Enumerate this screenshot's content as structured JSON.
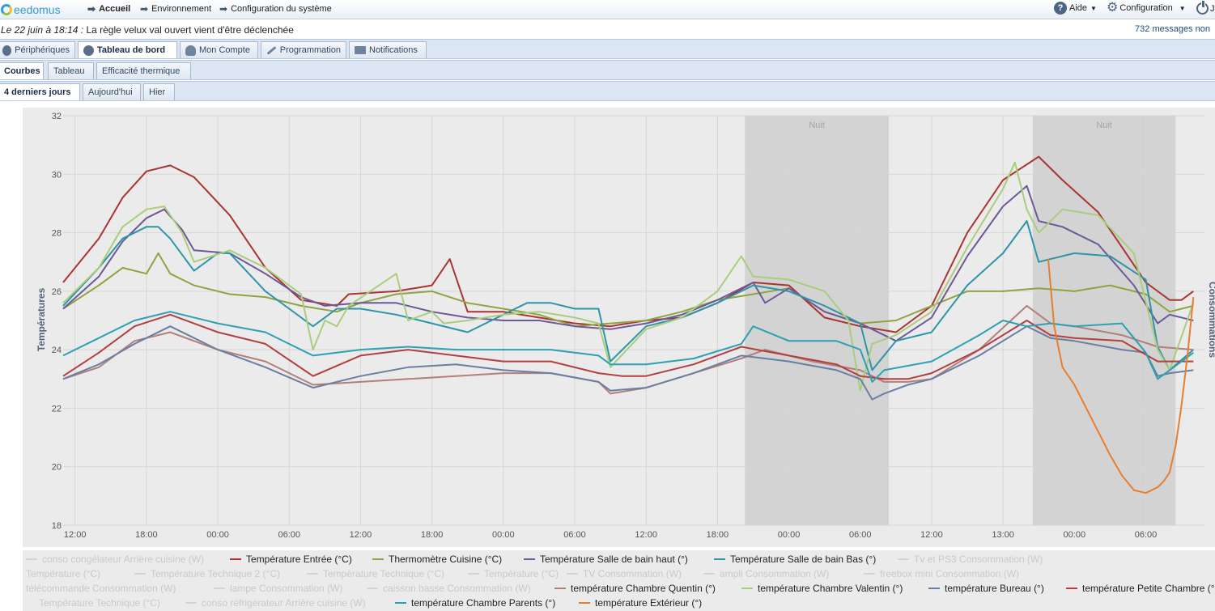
{
  "topbar": {
    "logo": "eedomus",
    "nav": [
      "Accueil",
      "Environnement",
      "Configuration du système"
    ],
    "help": "Aide",
    "config": "Configuration",
    "user_initial": "J"
  },
  "message": {
    "date": "Le 22 juin à 18:14 :",
    "text": "La règle velux val ouvert vient d'être déclenchée",
    "count": "732 messages non"
  },
  "main_tabs": [
    "Périphériques",
    "Tableau de bord",
    "Mon Compte",
    "Programmation",
    "Notifications"
  ],
  "sub_tabs": [
    "Courbes",
    "Tableau",
    "Efficacité thermique"
  ],
  "period_tabs": [
    "4 derniers jours",
    "Aujourd'hui",
    "Hier"
  ],
  "chart_data": {
    "type": "line",
    "ylabel": "Températures",
    "y2label": "Consommations",
    "ylim": [
      18,
      32
    ],
    "yticks": [
      18,
      20,
      22,
      24,
      26,
      28,
      30,
      32
    ],
    "xticks": [
      "12:00",
      "18:00",
      "00:00",
      "06:00",
      "12:00",
      "18:00",
      "00:00",
      "06:00",
      "12:00",
      "18:00",
      "00:00",
      "06:00",
      "12:00",
      "13:00",
      "00:00",
      "06:00"
    ],
    "x_hours": [
      0,
      6,
      12,
      18,
      24,
      30,
      36,
      42,
      48,
      54,
      60,
      66,
      72,
      78,
      84,
      90
    ],
    "x_range": [
      -1,
      95
    ],
    "night_bands": [
      {
        "label": "Nuit",
        "from": 56.3,
        "to": 68.4
      },
      {
        "label": "Nuit",
        "from": 80.5,
        "to": 92.5
      }
    ],
    "series": [
      {
        "name": "Température Entrée (°C)",
        "color": "#aa3333",
        "x": [
          -1,
          2,
          4,
          6,
          8,
          10,
          13,
          16,
          19,
          22,
          23,
          27,
          30,
          31.5,
          33,
          36,
          39,
          42,
          45,
          48,
          51,
          54,
          57,
          60,
          63,
          66,
          69,
          72,
          75,
          78,
          81,
          83,
          86,
          88,
          90,
          92,
          93,
          94
        ],
        "values": [
          26.3,
          27.8,
          29.2,
          30.1,
          30.3,
          29.9,
          28.6,
          26.8,
          25.7,
          25.5,
          25.9,
          26.0,
          26.2,
          27.1,
          25.3,
          25.3,
          25.1,
          24.9,
          24.8,
          25.0,
          25.1,
          25.6,
          26.3,
          26.2,
          25.1,
          24.8,
          24.6,
          25.5,
          28.0,
          29.8,
          30.6,
          29.8,
          28.7,
          27.5,
          26.3,
          25.7,
          25.7,
          26.0
        ]
      },
      {
        "name": "Thermomètre Cuisine (°C)",
        "color": "#8ea440",
        "x": [
          -1,
          2,
          4,
          6,
          7,
          8,
          10,
          13,
          16,
          19,
          22,
          24,
          27,
          30,
          33,
          36,
          39,
          42,
          45,
          48,
          51,
          54,
          57,
          60,
          63,
          66,
          69,
          72,
          75,
          78,
          81,
          84,
          87,
          90,
          92,
          94
        ],
        "values": [
          25.4,
          26.2,
          26.8,
          26.6,
          27.3,
          26.6,
          26.2,
          25.9,
          25.8,
          25.5,
          25.3,
          25.6,
          25.9,
          26.0,
          25.6,
          25.4,
          25.2,
          24.8,
          24.9,
          25.0,
          25.3,
          25.7,
          25.9,
          26.1,
          25.3,
          24.9,
          25.0,
          25.5,
          26.0,
          26.0,
          26.1,
          26.0,
          26.2,
          25.9,
          25.3,
          25.5
        ]
      },
      {
        "name": "Température Salle de bain haut (°)",
        "color": "#6d5898",
        "x": [
          -1,
          2,
          4,
          6,
          7.5,
          9,
          10,
          13,
          16,
          19,
          21,
          24,
          27,
          30,
          33,
          36,
          39,
          42,
          45,
          48,
          51,
          54,
          57,
          58,
          60,
          63,
          66,
          69,
          72,
          75,
          78,
          80,
          81,
          83,
          86,
          89,
          91,
          92,
          94
        ],
        "values": [
          25.4,
          26.5,
          27.7,
          28.5,
          28.8,
          28.1,
          27.4,
          27.3,
          26.6,
          25.8,
          25.5,
          25.6,
          25.6,
          25.3,
          25.1,
          25.0,
          25.0,
          24.8,
          24.7,
          24.9,
          25.2,
          25.7,
          26.3,
          25.6,
          26.1,
          25.3,
          24.9,
          24.3,
          25.1,
          27.2,
          28.9,
          29.6,
          28.4,
          28.2,
          27.6,
          26.2,
          24.9,
          25.2,
          25.0
        ]
      },
      {
        "name": "Température Salle de bain Bas (°)",
        "color": "#2e94a8",
        "x": [
          -1,
          2,
          4,
          6,
          7,
          8,
          10,
          12,
          13,
          16,
          18,
          20,
          22,
          24,
          27,
          30,
          33,
          36,
          38,
          40,
          42,
          44,
          45,
          48,
          51,
          54,
          57,
          60,
          63,
          66,
          67,
          69,
          72,
          75,
          78,
          80,
          81,
          84,
          87,
          90,
          91,
          92,
          94
        ],
        "values": [
          25.5,
          26.8,
          27.8,
          28.2,
          28.2,
          27.8,
          26.7,
          27.3,
          27.3,
          26.0,
          25.4,
          24.8,
          25.4,
          25.4,
          25.2,
          24.9,
          24.6,
          25.2,
          25.6,
          25.6,
          25.4,
          25.4,
          23.6,
          24.8,
          25.1,
          25.6,
          26.2,
          26.0,
          25.5,
          24.9,
          23.3,
          24.3,
          24.6,
          26.2,
          27.3,
          28.4,
          27.0,
          27.3,
          27.2,
          26.4,
          24.1,
          23.3,
          24.0
        ]
      },
      {
        "name": "température Chambre Quentin (°)",
        "color": "#b27f7a",
        "x": [
          -1,
          2,
          5,
          8,
          12,
          16,
          20,
          24,
          28,
          32,
          36,
          40,
          44,
          45,
          48,
          52,
          56,
          58,
          62,
          66,
          68,
          70,
          72,
          76,
          80,
          82,
          84,
          88,
          91,
          94
        ],
        "values": [
          23.0,
          23.4,
          24.3,
          24.6,
          24.0,
          23.6,
          22.8,
          22.9,
          23.0,
          23.1,
          23.2,
          23.2,
          22.9,
          22.5,
          22.7,
          23.2,
          23.7,
          24.0,
          23.6,
          23.3,
          22.9,
          22.9,
          23.0,
          24.0,
          25.5,
          24.9,
          24.8,
          24.5,
          24.1,
          24.0
        ]
      },
      {
        "name": "température Chambre Valentin (°)",
        "color": "#a9cd7d",
        "x": [
          -1,
          2,
          4,
          6,
          7.5,
          9,
          10,
          13,
          16,
          19,
          20,
          21,
          22,
          23,
          27,
          28,
          30,
          31,
          33,
          36,
          39,
          42,
          44,
          45,
          48,
          51,
          54,
          56,
          57,
          60,
          63,
          65,
          66,
          67,
          69,
          72,
          75,
          78,
          79,
          80,
          81,
          83,
          86,
          89,
          91,
          92,
          94
        ],
        "values": [
          25.6,
          26.8,
          28.2,
          28.8,
          28.9,
          28.0,
          27.0,
          27.4,
          26.8,
          25.9,
          24.0,
          25.0,
          24.8,
          25.5,
          26.6,
          25.0,
          25.3,
          24.9,
          25.0,
          25.2,
          25.3,
          25.1,
          24.9,
          23.4,
          24.7,
          25.1,
          26.0,
          27.2,
          26.5,
          26.4,
          26.0,
          25.0,
          22.6,
          24.2,
          24.5,
          25.3,
          27.5,
          29.5,
          30.4,
          28.8,
          28.0,
          28.8,
          28.6,
          27.3,
          24.0,
          23.3,
          25.6
        ]
      },
      {
        "name": "température Bureau (°)",
        "color": "#6a7fa0",
        "x": [
          -1,
          2,
          5,
          8,
          12,
          16,
          20,
          24,
          28,
          32,
          36,
          40,
          44,
          45,
          48,
          52,
          56,
          60,
          64,
          66,
          67,
          68,
          70,
          72,
          76,
          80,
          82,
          84,
          88,
          90,
          91,
          92,
          94
        ],
        "values": [
          23.0,
          23.5,
          24.2,
          24.8,
          24.0,
          23.4,
          22.7,
          23.1,
          23.4,
          23.5,
          23.3,
          23.2,
          22.9,
          22.6,
          22.7,
          23.2,
          23.8,
          23.6,
          23.3,
          23.0,
          22.3,
          22.5,
          22.8,
          23.0,
          23.8,
          24.8,
          24.4,
          24.3,
          24.0,
          23.9,
          23.1,
          23.2,
          23.3
        ]
      },
      {
        "name": "température Petite Chambre (°)",
        "color": "#b24040",
        "x": [
          -1,
          2,
          5,
          8,
          12,
          16,
          20,
          24,
          28,
          32,
          36,
          40,
          44,
          46,
          48,
          52,
          56,
          60,
          64,
          66,
          68,
          70,
          72,
          76,
          80,
          82,
          84,
          88,
          91,
          94
        ],
        "values": [
          23.1,
          23.9,
          24.8,
          25.2,
          24.6,
          24.2,
          23.1,
          23.8,
          24.0,
          23.8,
          23.6,
          23.6,
          23.2,
          23.1,
          23.1,
          23.5,
          24.1,
          23.8,
          23.5,
          23.1,
          23.0,
          23.0,
          23.2,
          24.0,
          25.0,
          24.5,
          24.4,
          24.3,
          23.6,
          23.6
        ]
      },
      {
        "name": "température Chambre Parents (°)",
        "color": "#2da0b3",
        "x": [
          -1,
          2,
          5,
          8,
          12,
          16,
          20,
          24,
          28,
          32,
          36,
          40,
          44,
          45,
          48,
          52,
          56,
          57,
          60,
          64,
          66,
          67,
          68,
          72,
          76,
          78,
          79,
          80,
          82,
          84,
          88,
          90,
          91,
          94
        ],
        "values": [
          23.8,
          24.4,
          25.0,
          25.3,
          24.9,
          24.6,
          23.8,
          24.0,
          24.1,
          24.0,
          24.0,
          24.0,
          23.8,
          23.5,
          23.5,
          23.7,
          24.2,
          24.8,
          24.3,
          24.3,
          24.0,
          22.9,
          23.3,
          23.6,
          24.5,
          25.0,
          24.9,
          24.8,
          24.9,
          24.8,
          24.9,
          23.9,
          23.0,
          23.9
        ]
      },
      {
        "name": "température Extérieur (°)",
        "color": "#e87e2d",
        "x": [
          81.8,
          82.3,
          83,
          84,
          85,
          86,
          87,
          88,
          89,
          90,
          91,
          91.5,
          92,
          92.5,
          93,
          93.5,
          94
        ],
        "values": [
          27.1,
          24.8,
          23.4,
          22.8,
          22.0,
          21.2,
          20.4,
          19.7,
          19.2,
          19.1,
          19.3,
          19.5,
          19.8,
          20.7,
          22.1,
          23.8,
          25.8
        ]
      }
    ]
  },
  "legend_inactive": [
    "conso congélateur Arrière cuisine (W)",
    "Tv et PS3 Consommation (W)",
    "Température (°C)",
    "Température Technique 2 (°C)",
    "Température Technique (°C)",
    "Température (°C)",
    "TV Consommation (W)",
    "ampli Consommation (W)",
    "freebox mini Consommation (W)",
    "télécommande Consommation (W)",
    "lampe Consommation (W)",
    "caisson basse Consommation (W)",
    "Température Technique (°C)",
    "conso réfrigérateur Arrière cuisine (W)"
  ]
}
